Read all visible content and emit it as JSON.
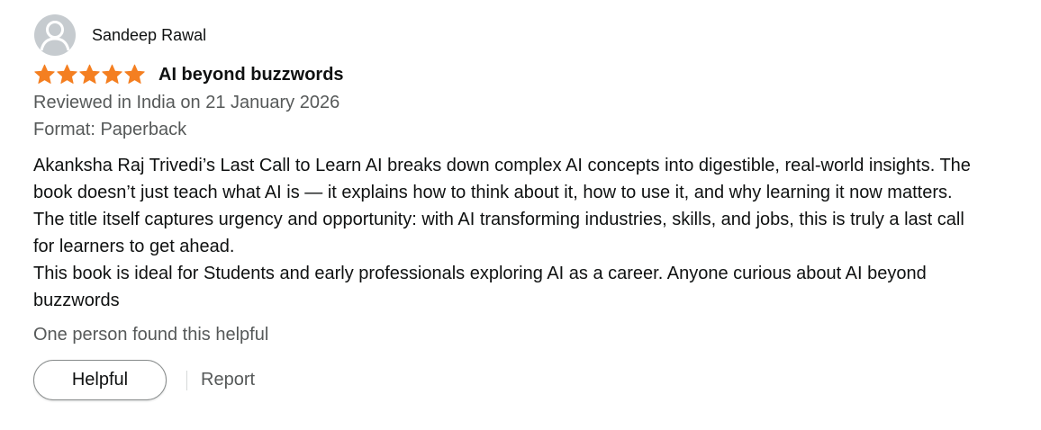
{
  "reviewer": {
    "name": "Sandeep Rawal",
    "avatar_icon": "user-silhouette-icon"
  },
  "review": {
    "rating": 5,
    "rating_max": 5,
    "star_color": "#f47f21",
    "title": "AI beyond buzzwords",
    "date_line": "Reviewed in India on 21 January 2026",
    "format_line": "Format: Paperback",
    "body_lines": [
      "Akanksha Raj Trivedi’s Last Call to Learn AI breaks down complex AI concepts into digestible, real-world insights. The book doesn’t just teach what AI is — it explains how to think about it, how to use it, and why learning it now matters. The title itself captures urgency and opportunity: with AI transforming industries, skills, and jobs, this is truly a last call for learners to get ahead.",
      "This book is ideal for Students and early professionals exploring AI as a career. Anyone curious about AI beyond buzzwords"
    ],
    "helpful_count_text": "One person found this helpful"
  },
  "actions": {
    "helpful_label": "Helpful",
    "report_label": "Report"
  }
}
